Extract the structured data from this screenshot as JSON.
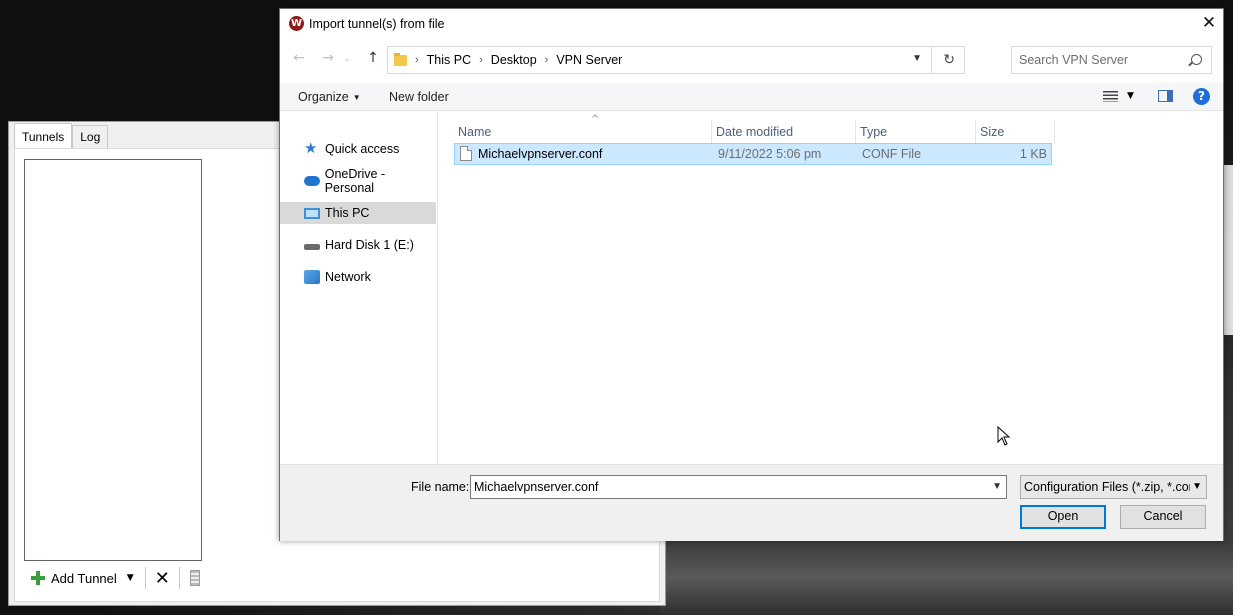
{
  "wireguard": {
    "tabs": [
      {
        "label": "Tunnels",
        "active": true
      },
      {
        "label": "Log",
        "active": false
      }
    ],
    "toolbar": {
      "add_tunnel_label": "Add Tunnel"
    }
  },
  "dialog": {
    "title": "Import tunnel(s) from file",
    "address": {
      "crumbs": [
        "This PC",
        "Desktop",
        "VPN Server"
      ]
    },
    "search": {
      "placeholder": "Search VPN Server"
    },
    "commands": {
      "organize": "Organize",
      "new_folder": "New folder"
    },
    "nav_pane": {
      "items": [
        {
          "label": "Quick access",
          "icon": "star-icon"
        },
        {
          "label": "OneDrive - Personal",
          "icon": "cloud-icon"
        },
        {
          "label": "This PC",
          "icon": "computer-icon",
          "selected": true
        },
        {
          "label": "Hard Disk 1 (E:)",
          "icon": "drive-icon"
        },
        {
          "label": "Network",
          "icon": "network-icon"
        }
      ]
    },
    "columns": {
      "name": "Name",
      "date": "Date modified",
      "type": "Type",
      "size": "Size"
    },
    "files": [
      {
        "name": "Michaelvpnserver.conf",
        "date": "9/11/2022 5:06 pm",
        "type": "CONF File",
        "size": "1 KB",
        "selected": true
      }
    ],
    "file_name": {
      "label": "File name:",
      "value": "Michaelvpnserver.conf"
    },
    "filter": {
      "selected": "Configuration Files (*.zip, *.con"
    },
    "buttons": {
      "open": "Open",
      "cancel": "Cancel"
    },
    "colors": {
      "selection_bg": "#cce8ff",
      "selection_border": "#99d1ff",
      "primary_border": "#0078d7",
      "header_text": "#4c607a"
    }
  }
}
